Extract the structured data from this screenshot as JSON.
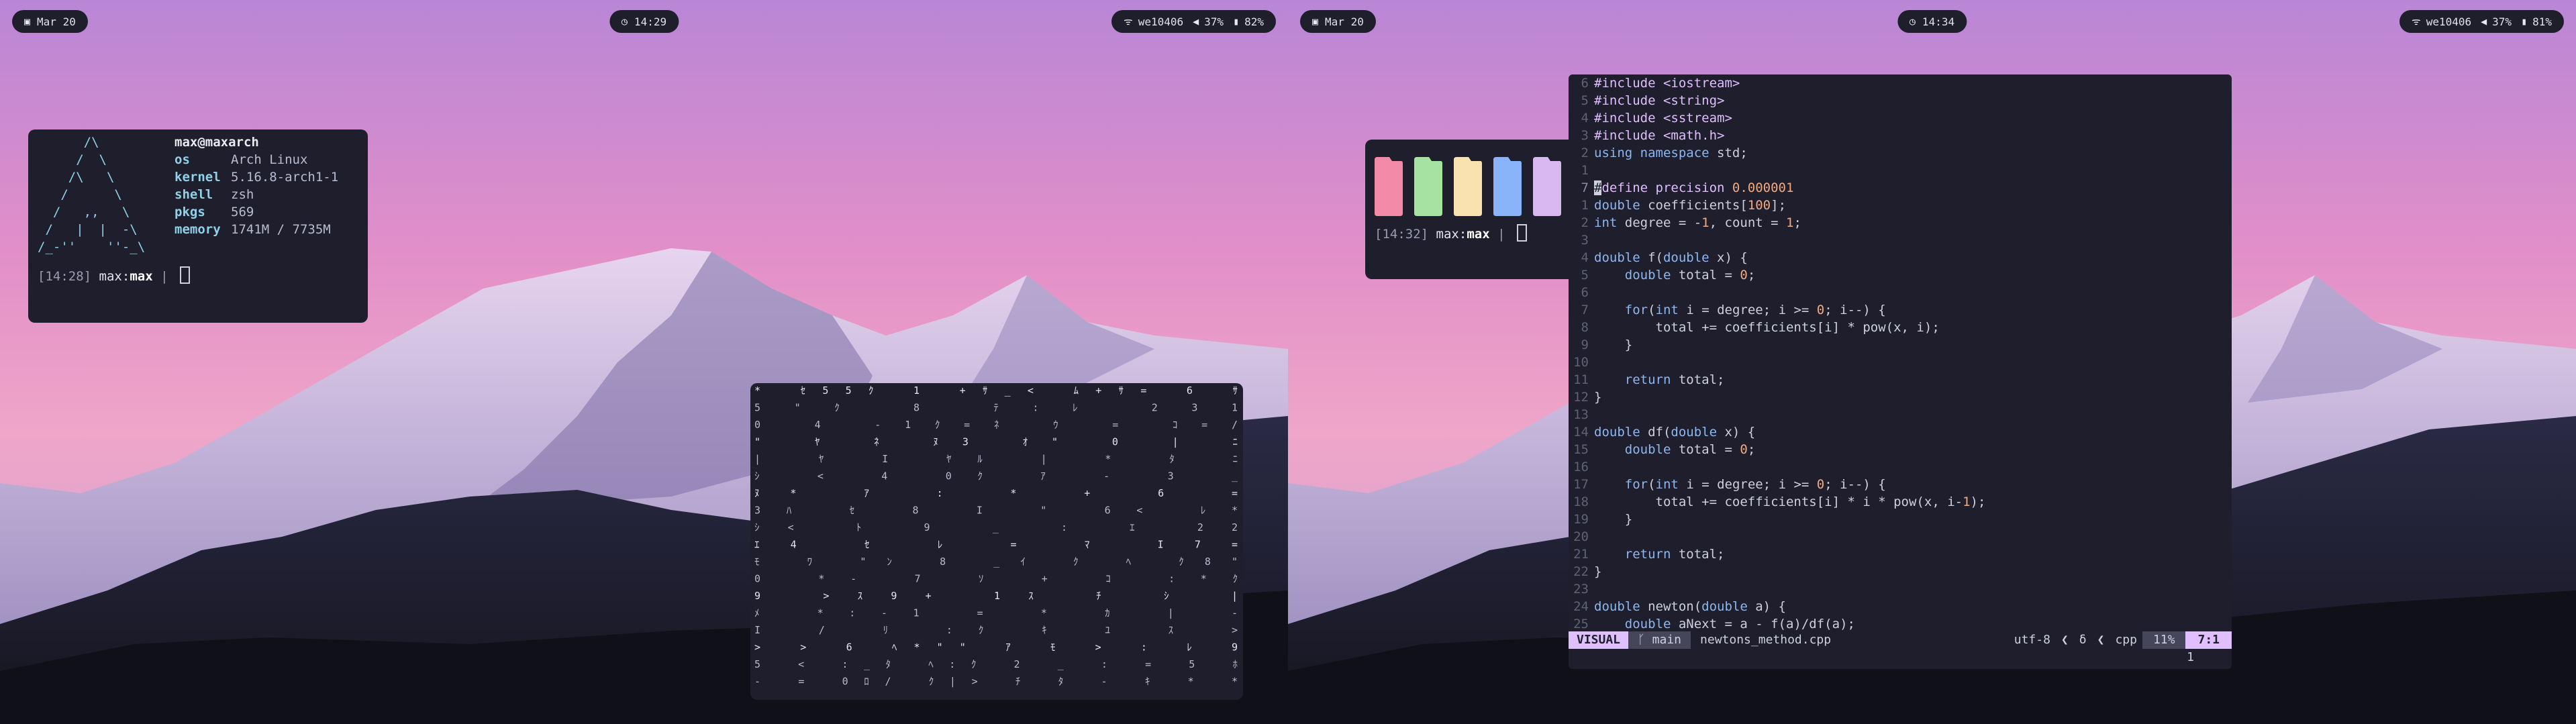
{
  "left_screen": {
    "bar": {
      "date": "Mar 20",
      "time": "14:29",
      "wifi": "we10406",
      "volume": "37%",
      "battery": "82%"
    },
    "fetch": {
      "title": "max@maxarch",
      "rows": [
        {
          "key": "os",
          "value": "Arch Linux"
        },
        {
          "key": "kernel",
          "value": "5.16.8-arch1-1"
        },
        {
          "key": "shell",
          "value": "zsh"
        },
        {
          "key": "pkgs",
          "value": "569"
        },
        {
          "key": "memory",
          "value": "1741M / 7735M"
        }
      ],
      "prompt_time": "[14:28]",
      "prompt_user": "max",
      "prompt_host": "max",
      "prompt_sep": "|"
    }
  },
  "right_screen": {
    "bar": {
      "date": "Mar 20",
      "time": "14:34",
      "wifi": "we10406",
      "volume": "37%",
      "battery": "81%"
    },
    "palette": {
      "colors": [
        "#f38ba8",
        "#a6e3a1",
        "#f9e2af",
        "#89b4fa",
        "#d9b8f0",
        "#f5c2e7",
        "#b4b4bc"
      ],
      "prompt_time": "[14:32]",
      "prompt_user": "max",
      "prompt_host": "max",
      "prompt_sep": "|"
    },
    "editor": {
      "lines": [
        {
          "n": "6",
          "t": "#include <iostream>"
        },
        {
          "n": "5",
          "t": "#include <string>"
        },
        {
          "n": "4",
          "t": "#include <sstream>"
        },
        {
          "n": "3",
          "t": "#include <math.h>"
        },
        {
          "n": "2",
          "t": "using namespace std;"
        },
        {
          "n": "1",
          "t": ""
        },
        {
          "n": "7",
          "t": "#define precision 0.000001"
        },
        {
          "n": "1",
          "t": "double coefficients[100];"
        },
        {
          "n": "2",
          "t": "int degree = -1, count = 1;"
        },
        {
          "n": "3",
          "t": ""
        },
        {
          "n": "4",
          "t": "double f(double x) {"
        },
        {
          "n": "5",
          "t": "    double total = 0;"
        },
        {
          "n": "6",
          "t": ""
        },
        {
          "n": "7",
          "t": "    for(int i = degree; i >= 0; i--) {"
        },
        {
          "n": "8",
          "t": "        total += coefficients[i] * pow(x, i);"
        },
        {
          "n": "9",
          "t": "    }"
        },
        {
          "n": "10",
          "t": ""
        },
        {
          "n": "11",
          "t": "    return total;"
        },
        {
          "n": "12",
          "t": "}"
        },
        {
          "n": "13",
          "t": ""
        },
        {
          "n": "14",
          "t": "double df(double x) {"
        },
        {
          "n": "15",
          "t": "    double total = 0;"
        },
        {
          "n": "16",
          "t": ""
        },
        {
          "n": "17",
          "t": "    for(int i = degree; i >= 0; i--) {"
        },
        {
          "n": "18",
          "t": "        total += coefficients[i] * i * pow(x, i-1);"
        },
        {
          "n": "19",
          "t": "    }"
        },
        {
          "n": "20",
          "t": ""
        },
        {
          "n": "21",
          "t": "    return total;"
        },
        {
          "n": "22",
          "t": "}"
        },
        {
          "n": "23",
          "t": ""
        },
        {
          "n": "24",
          "t": "double newton(double a) {"
        },
        {
          "n": "25",
          "t": "    double aNext = a - f(a)/df(a);"
        }
      ],
      "status": {
        "mode": "VISUAL",
        "branch": "main",
        "filename": "newtons_method.cpp",
        "encoding": "utf-8",
        "filetype": "cpp",
        "percent": "11%",
        "position": "7:1"
      },
      "cmdline": "1"
    }
  },
  "matrix": {
    "rows": [
      " *        ｾ55ｸ 1  +ｻ_<  ﾑ+ｻ=   6  ｻ",
      "          5\"ｸ  8  ﾃ:ﾚ  231        ",
      "0      4  -1ｸ=ﾈ  ｳ  =  ｺ=/         ",
      "\" ﾔ    ﾈ  ﾇ3  ｵ\"  0  |  ﾆ         ",
      "| ﾔ    I  ﾔﾙ  |  *  ﾀ  ﾆ          ",
      "ｼ <    4  0ｸ  ｱ  -  3           _ ",
      "ﾇ* ｱ    :  *  +  6            =  ",
      "3ﾊ ｾ    8  I  \"  6<        ﾚ*    ",
      "ｼ< ﾄ    9     _  :   ｴ    22     ",
      "ｴ4 ｾ          ﾚ  =   ﾏ    I7=    ",
      " ﾓ ﾜ   \"ﾝ  8 _ｲ  ｸ   ﾍ    ｸ8\"    ",
      " 0     *-  7  ｿ  +   ｺ    :*ｸ    ",
      "9      >ｽ9+  1ｽ  ﾁ   ｼ    |      ",
      "ﾒ      *:-1   =  *   ｶ    |   -  ",
      "I /    ﾘ :ｸ   ｷ  ﾕ   ｽ    >      ",
      "> > 6  ﾍ*\"\"  ｱ ﾓ  >   :   ﾚ  9   ",
      "5 < :_ﾀ ﾍ:ｸ  2 _  :   =   5  ﾎ   ",
      "- = 0ﾛ/ ｸ|>  ﾁ ﾀ  -   ｷ   *  *   "
    ]
  }
}
